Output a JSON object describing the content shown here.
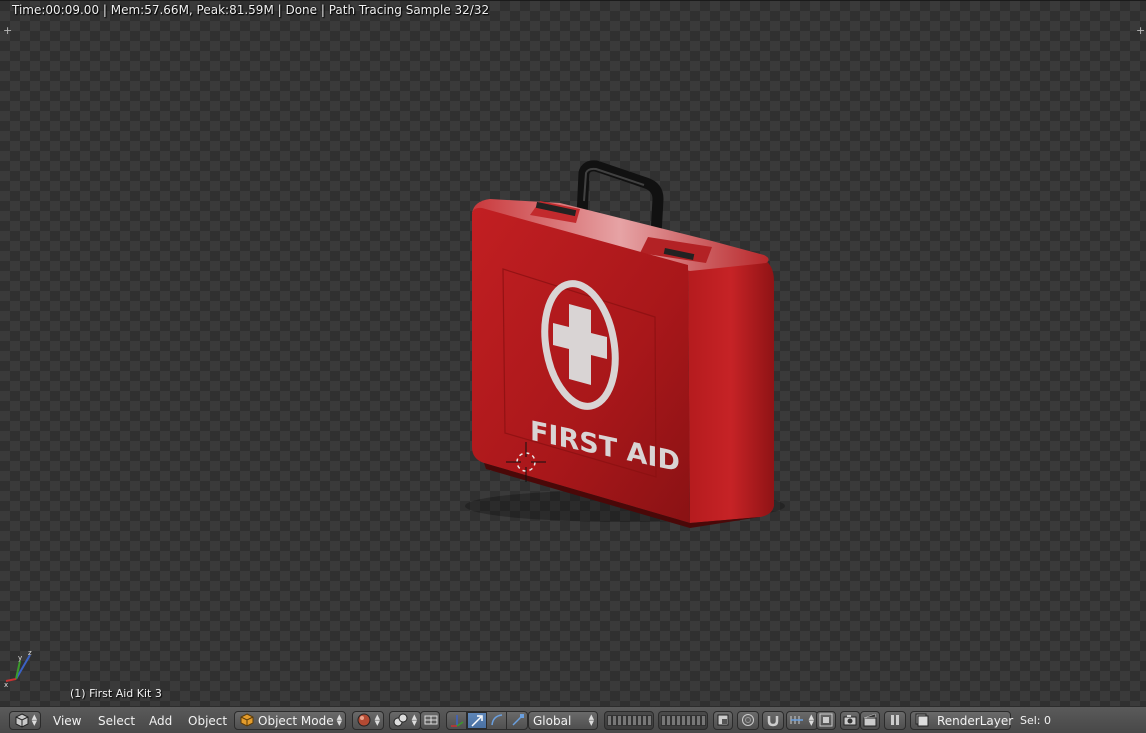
{
  "render_info": "Time:00:09.00 | Mem:57.66M, Peak:81.59M | Done | Path Tracing Sample 32/32",
  "object_label": "(1) First Aid Kit 3",
  "scene": {
    "kit_text": "FIRST AID",
    "kit_color": "#b3191c",
    "kit_symbol_color": "#d9d4d4"
  },
  "header": {
    "menus": {
      "view": "View",
      "select": "Select",
      "add": "Add",
      "object": "Object"
    },
    "mode": "Object Mode",
    "orientation": "Global",
    "render_layer": "RenderLayer",
    "selection": "Sel: 0"
  },
  "colors": {
    "header_bg": "#4f4f4f",
    "active_button": "#5680b3",
    "viewport_checker_dark": "#303030",
    "viewport_checker_light": "#3a3a3a"
  }
}
